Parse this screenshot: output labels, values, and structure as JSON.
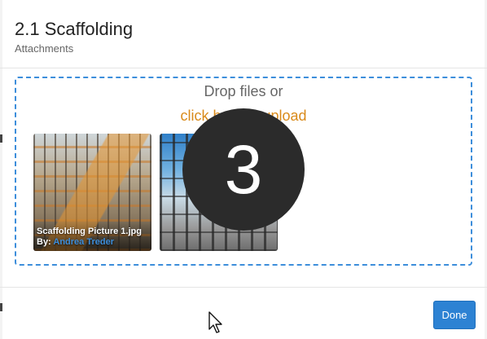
{
  "modal": {
    "title": "2.1 Scaffolding",
    "subtitle": "Attachments"
  },
  "dropzone": {
    "drop_text": "Drop files or",
    "upload_link": "click here to upload"
  },
  "attachments": [
    {
      "caption": "Scaffolding Picture 1.jpg",
      "by_label": "By:",
      "author": "Andrea Treder"
    },
    {
      "caption": "",
      "by_label": "",
      "author": ""
    }
  ],
  "overlay": {
    "step_number": "3"
  },
  "footer": {
    "done_label": "Done"
  },
  "colors": {
    "accent": "#3d8edb",
    "link": "#d98a1a",
    "button": "#2d82d3",
    "badge": "#2b2b2b"
  },
  "icons": {
    "cursor": "mouse-pointer-icon"
  }
}
